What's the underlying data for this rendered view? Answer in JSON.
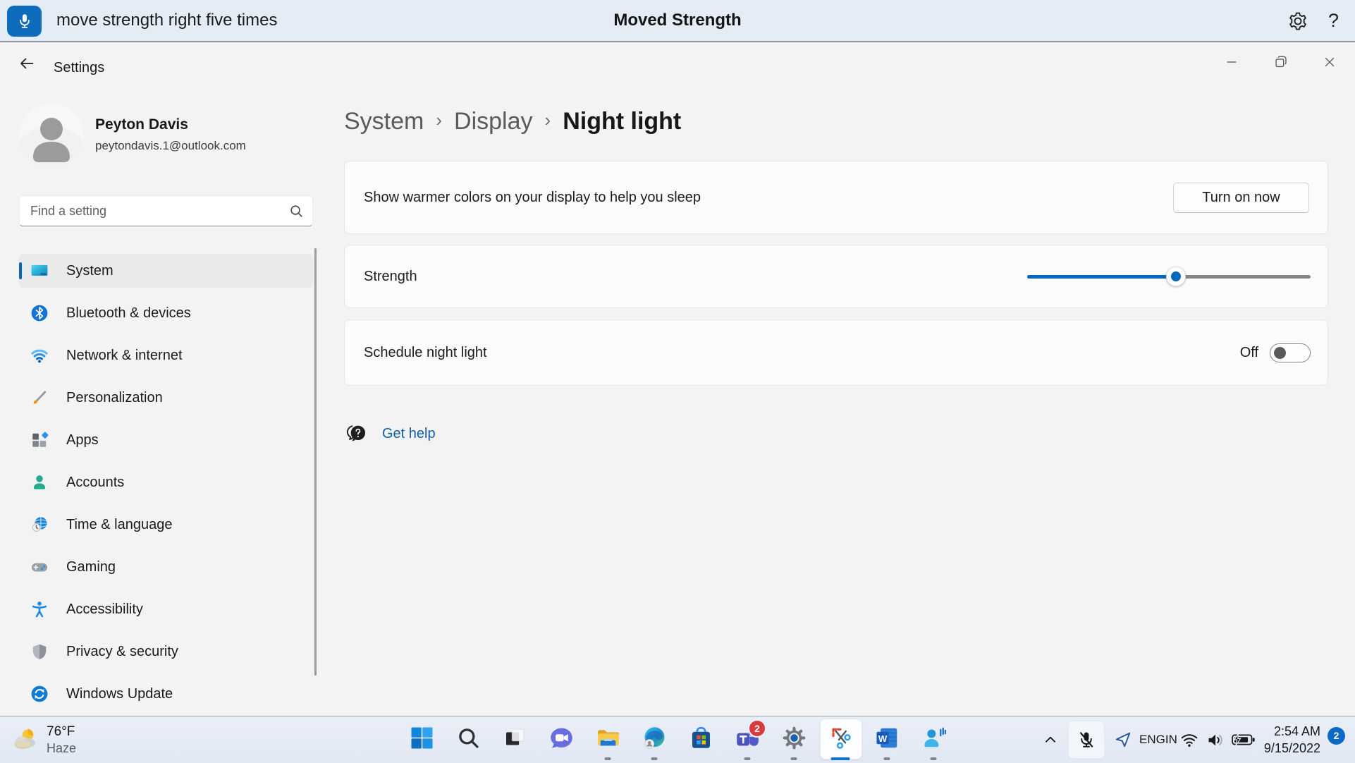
{
  "voice_bar": {
    "command": "move strength right five times",
    "title": "Moved Strength"
  },
  "settings_window": {
    "titlebar": {
      "title": "Settings"
    },
    "profile": {
      "name": "Peyton Davis",
      "email": "peytondavis.1@outlook.com"
    },
    "search": {
      "placeholder": "Find a setting"
    },
    "sidebar": {
      "items": [
        {
          "label": "System",
          "icon": "system",
          "selected": true
        },
        {
          "label": "Bluetooth & devices",
          "icon": "bluetooth"
        },
        {
          "label": "Network & internet",
          "icon": "network"
        },
        {
          "label": "Personalization",
          "icon": "personalization"
        },
        {
          "label": "Apps",
          "icon": "apps"
        },
        {
          "label": "Accounts",
          "icon": "accounts"
        },
        {
          "label": "Time & language",
          "icon": "time"
        },
        {
          "label": "Gaming",
          "icon": "gaming"
        },
        {
          "label": "Accessibility",
          "icon": "accessibility"
        },
        {
          "label": "Privacy & security",
          "icon": "privacy"
        },
        {
          "label": "Windows Update",
          "icon": "update"
        }
      ]
    },
    "breadcrumb": {
      "path": [
        "System",
        "Display"
      ],
      "current": "Night light",
      "separator": "›"
    },
    "night_light": {
      "warmth_row": {
        "label": "Show warmer colors on your display to help you sleep",
        "button": "Turn on now"
      },
      "strength_row": {
        "label": "Strength",
        "slider_percent": 52.5
      },
      "schedule_row": {
        "label": "Schedule night light",
        "toggle_state": "Off"
      }
    },
    "get_help": {
      "label": "Get help"
    }
  },
  "taskbar": {
    "weather": {
      "temperature": "76°F",
      "condition": "Haze"
    },
    "apps": [
      {
        "name": "start"
      },
      {
        "name": "search"
      },
      {
        "name": "task-view"
      },
      {
        "name": "chat"
      },
      {
        "name": "file-explorer",
        "running": true
      },
      {
        "name": "edge",
        "running": true
      },
      {
        "name": "store"
      },
      {
        "name": "teams",
        "running": true,
        "badge": "2"
      },
      {
        "name": "settings",
        "running": true
      },
      {
        "name": "snipping-tool",
        "running": true,
        "active": true
      },
      {
        "name": "word",
        "running": true
      },
      {
        "name": "voice-access",
        "running": true
      }
    ],
    "tray": {
      "language": [
        "ENG",
        "IN"
      ],
      "time": "2:54 AM",
      "date": "9/15/2022",
      "notification_count": "2"
    }
  },
  "colors": {
    "accent": "#0067C0",
    "link": "#0E5CAB",
    "mic_button": "#0F6CBD",
    "teams_badge": "#D93B3B",
    "notification_badge": "#0B69C7"
  }
}
